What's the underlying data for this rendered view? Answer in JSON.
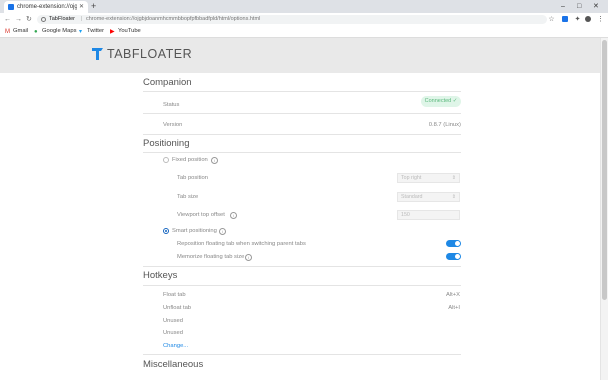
{
  "browser": {
    "tab_title": "chrome-extension://ojgb",
    "url_site": "TabFloater",
    "url_path": "chrome-extension://ojgbjdoanmhcmmbbopfpfbbadfpld/html/options.html",
    "new_tab_symbol": "+",
    "bookmarks": [
      {
        "label": "Gmail",
        "icon": "gmail-icon",
        "color": "#d93025"
      },
      {
        "label": "Google Maps",
        "icon": "maps-icon",
        "color": "#34a853"
      },
      {
        "label": "Twitter",
        "icon": "twitter-icon",
        "color": "#1da1f2"
      },
      {
        "label": "YouTube",
        "icon": "youtube-icon",
        "color": "#ff0000"
      }
    ]
  },
  "app": {
    "logo_text": "TABFLOATER",
    "accent_color": "#1e88e5"
  },
  "companion": {
    "title": "Companion",
    "status_label": "Status",
    "status_value": "Connected ✓",
    "version_label": "Version",
    "version_value": "0.8.7 (Linux)"
  },
  "positioning": {
    "title": "Positioning",
    "fixed_position_label": "Fixed position",
    "tab_position_label": "Tab position",
    "tab_position_value": "Top right",
    "tab_size_label": "Tab size",
    "tab_size_value": "Standard",
    "viewport_offset_label": "Viewport top offset",
    "viewport_offset_value": "150",
    "smart_positioning_label": "Smart positioning",
    "reposition_label": "Reposition floating tab when switching parent tabs",
    "memorize_label": "Memorize floating tab size",
    "selected_mode": "smart"
  },
  "hotkeys": {
    "title": "Hotkeys",
    "items": [
      {
        "label": "Float tab",
        "value": "Alt+X"
      },
      {
        "label": "Unfloat tab",
        "value": "Alt+I"
      },
      {
        "label": "Unused",
        "value": ""
      },
      {
        "label": "Unused",
        "value": ""
      }
    ],
    "change_link": "Change..."
  },
  "misc": {
    "title": "Miscellaneous"
  }
}
